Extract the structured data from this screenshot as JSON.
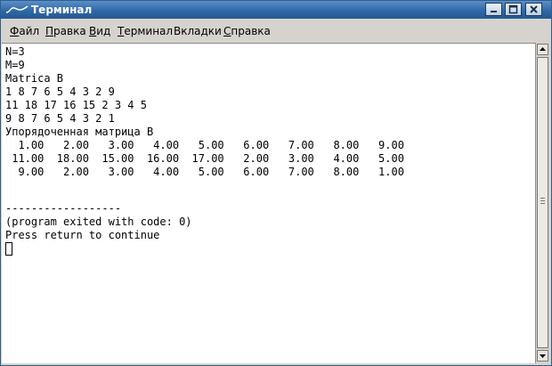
{
  "window": {
    "title": "Терминал",
    "buttons": [
      "minimize",
      "maximize",
      "close"
    ]
  },
  "menu": {
    "items": [
      {
        "label": "Файл",
        "mnemonic": "Ф",
        "rest": "айл"
      },
      {
        "label": "Правка",
        "mnemonic": "П",
        "rest": "равка"
      },
      {
        "label": "Вид",
        "mnemonic": "В",
        "rest": "ид"
      },
      {
        "label": "Терминал",
        "mnemonic": "Т",
        "rest": "ерминал"
      },
      {
        "label": "Вкладки",
        "mnemonic": "",
        "rest": "Вкладки"
      },
      {
        "label": "Справка",
        "mnemonic": "С",
        "rest": "правка"
      }
    ]
  },
  "terminal": {
    "lines": [
      "N=3",
      "M=9",
      "Matrica B",
      "1 8 7 6 5 4 3 2 9",
      "11 18 17 16 15 2 3 4 5",
      "9 8 7 6 5 4 3 2 1",
      "Упорядоченная матрица B",
      "  1.00   2.00   3.00   4.00   5.00   6.00   7.00   8.00   9.00",
      " 11.00  18.00  15.00  16.00  17.00   2.00   3.00   4.00   5.00",
      "  9.00   2.00   3.00   4.00   5.00   6.00   7.00   8.00   1.00",
      "",
      "",
      "",
      "------------------",
      "(program exited with code: 0)",
      "Press return to continue"
    ]
  },
  "icons": {
    "app": "terminal-icon",
    "minimize": "minimize-icon",
    "maximize": "maximize-icon",
    "close": "close-icon",
    "scroll_up": "arrow-up-icon",
    "scroll_down": "arrow-down-icon"
  }
}
